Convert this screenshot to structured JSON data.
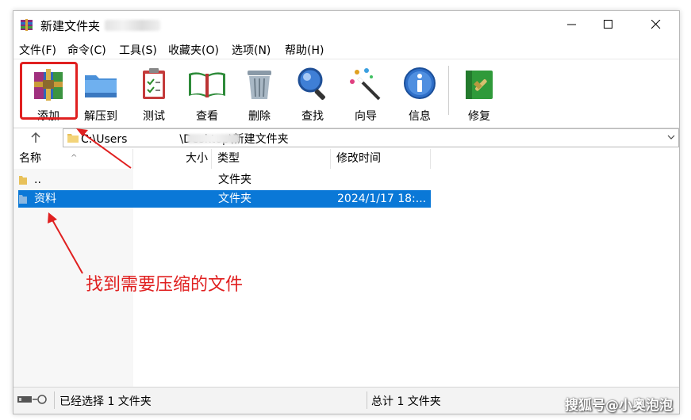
{
  "window": {
    "title": "新建文件夹",
    "controls": {
      "minimize": "minimize",
      "maximize": "maximize",
      "close": "close"
    }
  },
  "menu": [
    "文件(F)",
    "命令(C)",
    "工具(S)",
    "收藏夹(O)",
    "选项(N)",
    "帮助(H)"
  ],
  "toolbar": {
    "add": "添加",
    "extract": "解压到",
    "test": "测试",
    "view": "查看",
    "delete": "删除",
    "find": "查找",
    "wizard": "向导",
    "info": "信息",
    "repair": "修复"
  },
  "address": {
    "path_prefix": "C:\\Users",
    "path_suffix": "\\Desktop\\新建文件夹"
  },
  "columns": {
    "name": "名称",
    "size": "大小",
    "type": "类型",
    "modified": "修改时间"
  },
  "rows": [
    {
      "name": "..",
      "size": "",
      "type": "文件夹",
      "modified": "",
      "selected": false
    },
    {
      "name": "资料",
      "size": "",
      "type": "文件夹",
      "modified": "2024/1/17 18:...",
      "selected": true
    }
  ],
  "status": {
    "left": "已经选择 1 文件夹",
    "right": "总计 1 文件夹"
  },
  "annotation": {
    "callout": "找到需要压缩的文件",
    "color": "#e02020"
  },
  "watermark": "搜狐号@小奥泡泡",
  "colors": {
    "selection": "#0a78d7",
    "accent_red": "#e02020"
  }
}
